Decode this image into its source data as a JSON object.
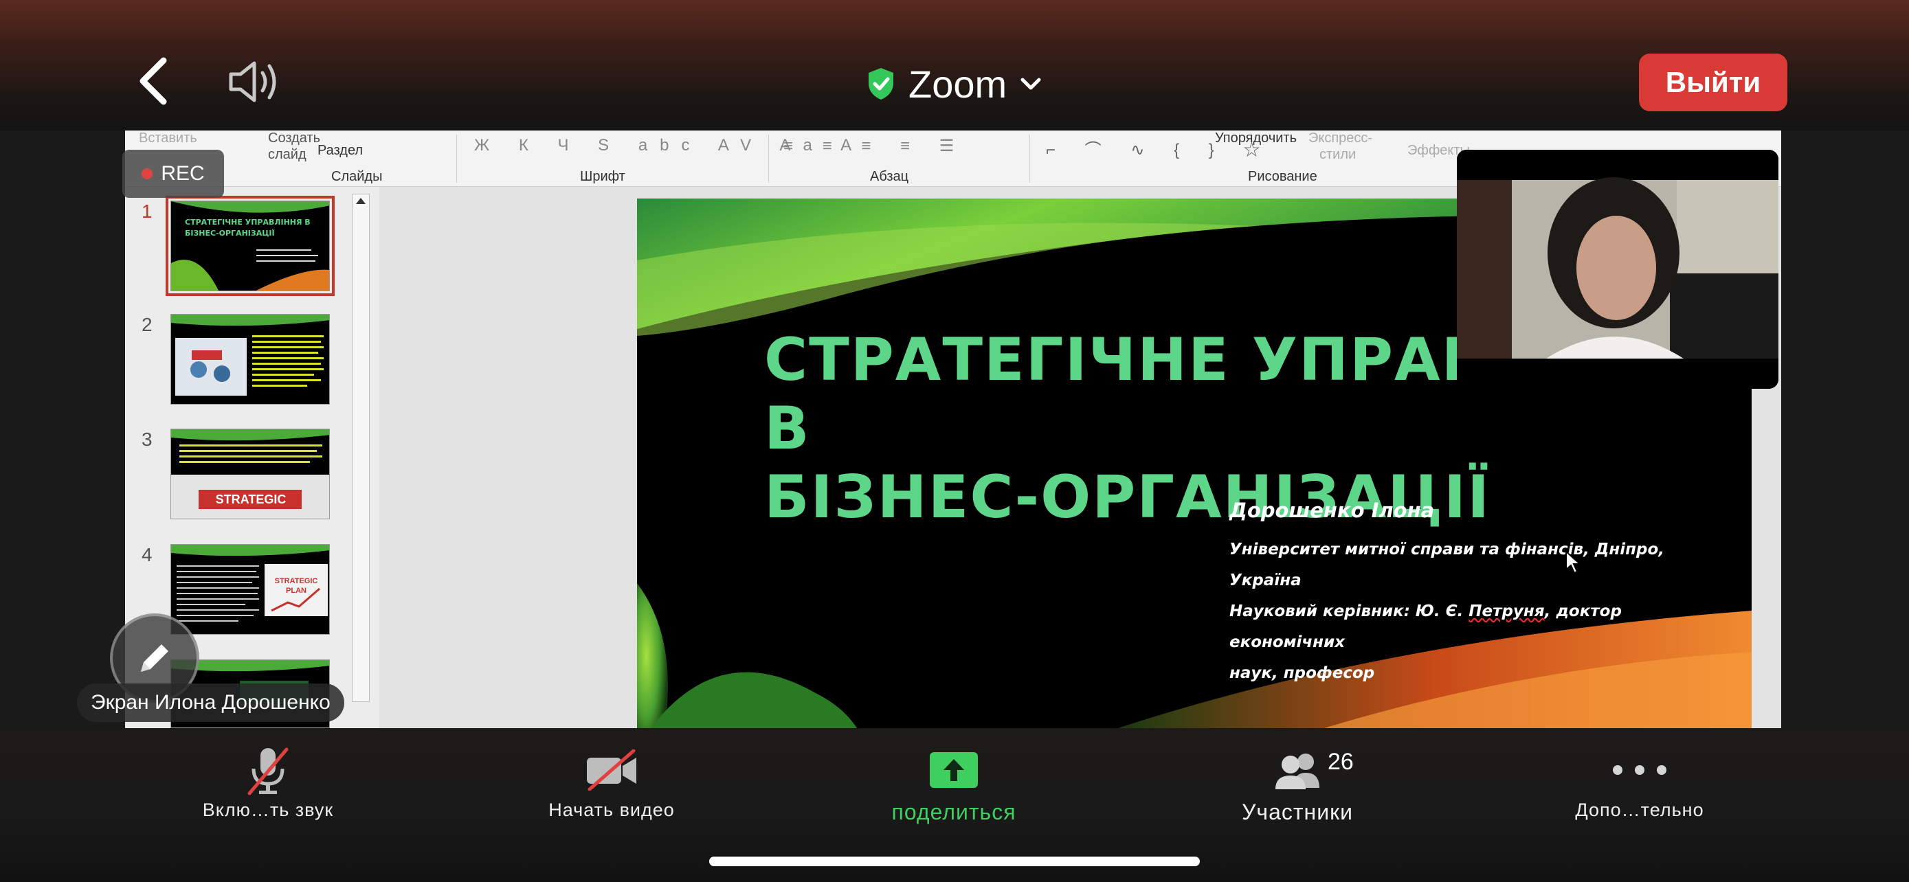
{
  "header": {
    "meeting_title": "Zoom",
    "leave_label": "Выйти"
  },
  "ribbon": {
    "insert_label": "Вставить",
    "new_slide_label_1": "Создать",
    "new_slide_label_2": "слайд",
    "section_label": "Раздел",
    "group_slides": "Слайды",
    "group_font": "Шрифт",
    "group_paragraph": "Абзац",
    "group_drawing": "Рисование",
    "arrange_label": "Упорядочить",
    "quick_styles_1": "Экспресс-",
    "quick_styles_2": "стили",
    "effects_label": "Эффекты"
  },
  "thumbnails": [
    {
      "number": "1",
      "selected": true
    },
    {
      "number": "2",
      "selected": false
    },
    {
      "number": "3",
      "selected": false
    },
    {
      "number": "4",
      "selected": false
    }
  ],
  "thumb_text": {
    "t1_title_1": "СТРАТЕГІЧНЕ УПРАВЛІННЯ В",
    "t1_title_2": "БІЗНЕС-ОРГАНІЗАЦІЇ",
    "t3_banner": "STRATEGIC",
    "t4_banner_1": "STRATEGIC",
    "t4_banner_2": "PLAN"
  },
  "slide": {
    "title_line1": "СТРАТЕГІЧНЕ УПРАВЛІННЯ В",
    "title_line2": "БІЗНЕС-ОРГАНІЗАЦІЇ",
    "author": "Дорошенко Ілона",
    "line1": "Університет митної справи та фінансів,  Дніпро, Україна",
    "line2_pre": "Науковий керівник: Ю. Є. ",
    "line2_name": "Петруня",
    "line2_post": ", доктор економічних",
    "line3": "наук, професор"
  },
  "recording": {
    "label": "REC"
  },
  "screen_owner": "Экран Илона Дорошенко",
  "toolbar": {
    "mute_label": "Вклю…ть звук",
    "video_label": "Начать видео",
    "share_label": "поделиться",
    "participants_label": "Участники",
    "participants_count": "26",
    "more_label": "Допо…тельно"
  },
  "colors": {
    "leave_button": "#d93a35",
    "share_green": "#3fcf5e",
    "slide_title": "#5dd68a",
    "rec_dot": "#e0443e"
  },
  "icons": [
    "back-chevron-icon",
    "speaker-icon",
    "shield-check-icon",
    "chevron-down-icon",
    "pencil-icon",
    "mic-off-icon",
    "video-off-icon",
    "share-arrow-icon",
    "participants-icon",
    "more-dots-icon",
    "mouse-cursor-icon"
  ]
}
